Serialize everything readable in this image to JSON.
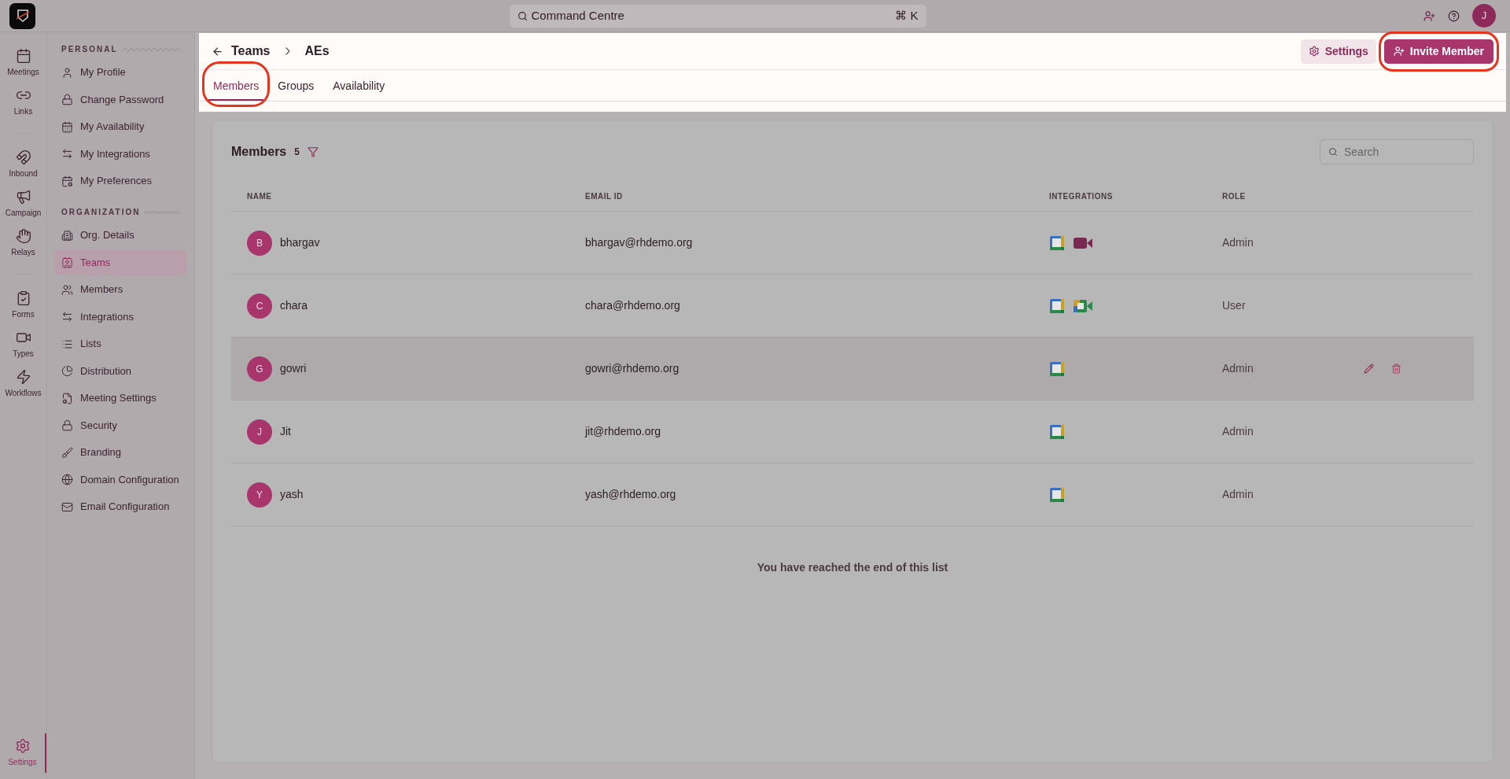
{
  "topbar": {
    "search_label": "Command Centre",
    "shortcut": "⌘ K",
    "avatar": "J"
  },
  "rail": {
    "groups": [
      [
        {
          "label": "Meetings",
          "selected": false
        },
        {
          "label": "Links",
          "selected": false
        }
      ],
      [
        {
          "label": "Inbound",
          "selected": false
        },
        {
          "label": "Campaign",
          "selected": false
        },
        {
          "label": "Relays",
          "selected": false
        }
      ],
      [
        {
          "label": "Forms",
          "selected": false
        },
        {
          "label": "Types",
          "selected": false
        },
        {
          "label": "Workflows",
          "selected": false
        }
      ]
    ],
    "bottom": {
      "label": "Settings",
      "selected": true
    }
  },
  "sidebar": {
    "sections": [
      {
        "title": "PERSONAL",
        "items": [
          {
            "label": "My Profile",
            "selected": false
          },
          {
            "label": "Change Password",
            "selected": false
          },
          {
            "label": "My Availability",
            "selected": false
          },
          {
            "label": "My Integrations",
            "selected": false
          },
          {
            "label": "My Preferences",
            "selected": false
          }
        ]
      },
      {
        "title": "ORGANIZATION",
        "items": [
          {
            "label": "Org. Details",
            "selected": false
          },
          {
            "label": "Teams",
            "selected": true
          },
          {
            "label": "Members",
            "selected": false
          },
          {
            "label": "Integrations",
            "selected": false
          },
          {
            "label": "Lists",
            "selected": false
          },
          {
            "label": "Distribution",
            "selected": false
          },
          {
            "label": "Meeting Settings",
            "selected": false
          },
          {
            "label": "Security",
            "selected": false
          },
          {
            "label": "Branding",
            "selected": false
          },
          {
            "label": "Domain Configuration",
            "selected": false
          },
          {
            "label": "Email Configuration",
            "selected": false
          }
        ]
      }
    ]
  },
  "header": {
    "breadcrumb": [
      "Teams",
      "AEs"
    ],
    "settings_button": "Settings",
    "invite_button": "Invite Member",
    "tabs": [
      {
        "label": "Members",
        "selected": true
      },
      {
        "label": "Groups",
        "selected": false
      },
      {
        "label": "Availability",
        "selected": false
      }
    ]
  },
  "members": {
    "title": "Members",
    "count": "5",
    "search_placeholder": "Search",
    "columns": [
      "NAME",
      "EMAIL ID",
      "INTEGRATIONS",
      "ROLE"
    ],
    "rows": [
      {
        "initial": "B",
        "name": "bhargav",
        "email": "bhargav@rhdemo.org",
        "integrations": [
          {
            "kind": "calendar"
          },
          {
            "kind": "zoom"
          }
        ],
        "role": "Admin",
        "hovered": false
      },
      {
        "initial": "C",
        "name": "chara",
        "email": "chara@rhdemo.org",
        "integrations": [
          {
            "kind": "calendar"
          },
          {
            "kind": "meet"
          }
        ],
        "role": "User",
        "hovered": false
      },
      {
        "initial": "G",
        "name": "gowri",
        "email": "gowri@rhdemo.org",
        "integrations": [
          {
            "kind": "calendar"
          }
        ],
        "role": "Admin",
        "hovered": true
      },
      {
        "initial": "J",
        "name": "Jit",
        "email": "jit@rhdemo.org",
        "integrations": [
          {
            "kind": "calendar"
          }
        ],
        "role": "Admin",
        "hovered": false
      },
      {
        "initial": "Y",
        "name": "yash",
        "email": "yash@rhdemo.org",
        "integrations": [
          {
            "kind": "calendar"
          }
        ],
        "role": "Admin",
        "hovered": false
      }
    ],
    "end_message": "You have reached the end of this list"
  }
}
